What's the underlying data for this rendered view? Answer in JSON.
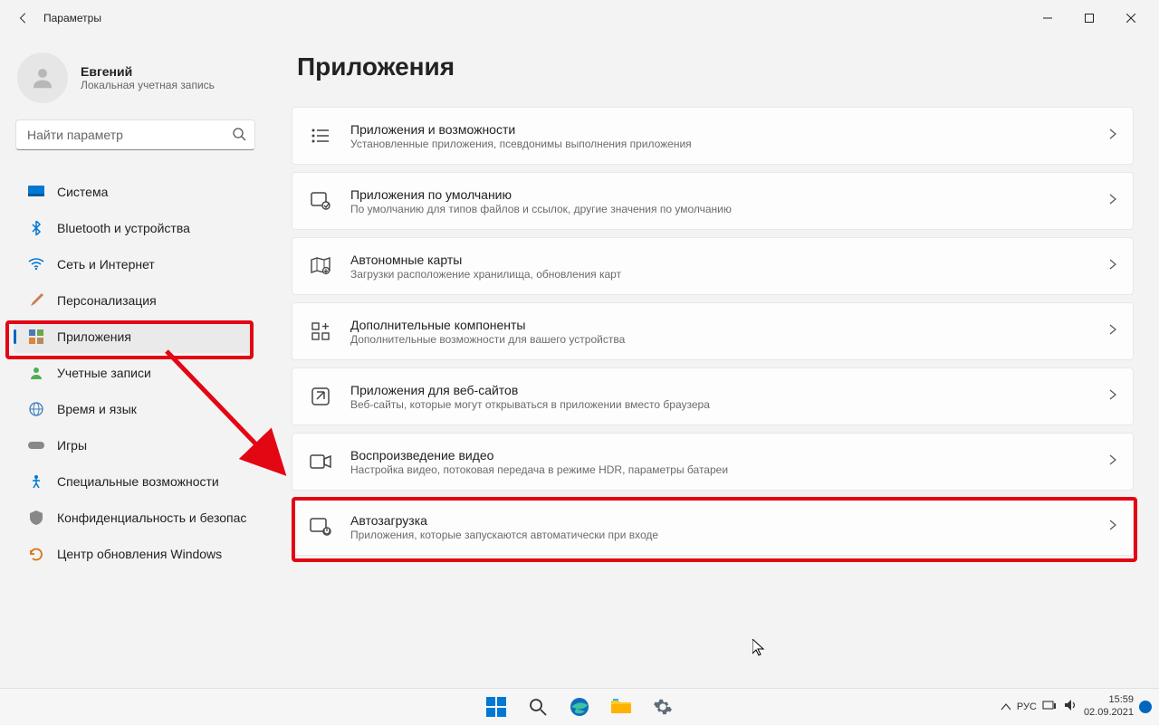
{
  "titlebar": {
    "title": "Параметры"
  },
  "user": {
    "name": "Евгений",
    "subtitle": "Локальная учетная запись"
  },
  "search": {
    "placeholder": "Найти параметр"
  },
  "nav": {
    "items": [
      {
        "label": "Система"
      },
      {
        "label": "Bluetooth и устройства"
      },
      {
        "label": "Сеть и Интернет"
      },
      {
        "label": "Персонализация"
      },
      {
        "label": "Приложения"
      },
      {
        "label": "Учетные записи"
      },
      {
        "label": "Время и язык"
      },
      {
        "label": "Игры"
      },
      {
        "label": "Специальные возможности"
      },
      {
        "label": "Конфиденциальность и безопас"
      },
      {
        "label": "Центр обновления Windows"
      }
    ]
  },
  "page": {
    "title": "Приложения"
  },
  "cards": [
    {
      "title": "Приложения и возможности",
      "sub": "Установленные приложения, псевдонимы выполнения приложения"
    },
    {
      "title": "Приложения по умолчанию",
      "sub": "По умолчанию для типов файлов и ссылок, другие значения по умолчанию"
    },
    {
      "title": "Автономные карты",
      "sub": "Загрузки расположение хранилища, обновления карт"
    },
    {
      "title": "Дополнительные компоненты",
      "sub": "Дополнительные возможности для вашего устройства"
    },
    {
      "title": "Приложения для веб-сайтов",
      "sub": "Веб-сайты, которые могут открываться в приложении вместо браузера"
    },
    {
      "title": "Воспроизведение видео",
      "sub": "Настройка видео, потоковая передача в режиме HDR, параметры батареи"
    },
    {
      "title": "Автозагрузка",
      "sub": "Приложения, которые запускаются автоматически при входе"
    }
  ],
  "taskbar": {
    "lang": "РУС",
    "time": "15:59",
    "date": "02.09.2021"
  },
  "annotation": {
    "highlight_color": "#e30613",
    "arrow_from": "sidebar-item-apps",
    "arrow_to": "card-startup"
  }
}
